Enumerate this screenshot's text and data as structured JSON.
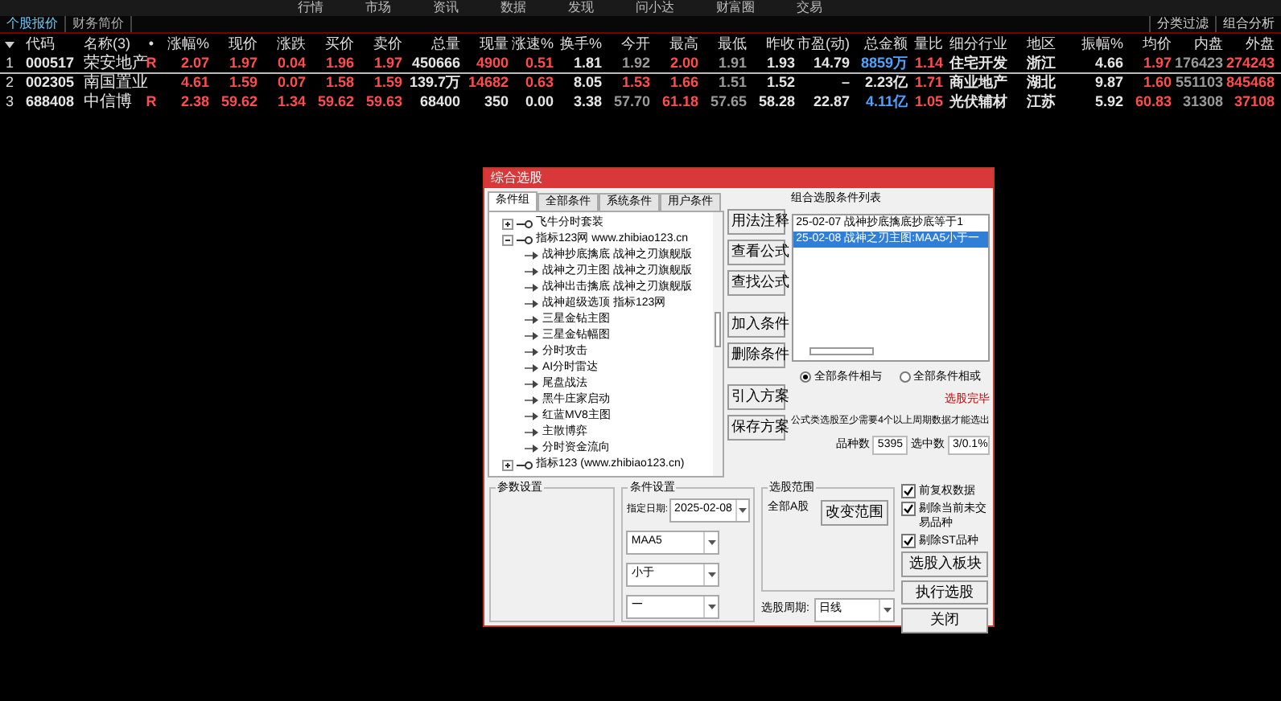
{
  "menu": [
    "行情",
    "市场",
    "资讯",
    "数据",
    "发现",
    "问小达",
    "财富圈",
    "交易"
  ],
  "subtabs": [
    {
      "label": "个股报价",
      "selected": true
    },
    {
      "label": "财务简价",
      "selected": false
    }
  ],
  "filters": [
    "分类过滤",
    "组合分析"
  ],
  "table": {
    "columns": [
      "代码",
      "名称(3)",
      "•",
      "涨幅%",
      "现价",
      "涨跌",
      "买价",
      "卖价",
      "总量",
      "现量",
      "涨速%",
      "换手%",
      "今开",
      "最高",
      "最低",
      "昨收",
      "市盈(动)",
      "总金额",
      "量比",
      "细分行业",
      "地区",
      "振幅%",
      "均价",
      "内盘",
      "外盘"
    ],
    "rows": [
      {
        "num": "1",
        "selected": true,
        "cells": [
          {
            "text": "000517",
            "kind": "flat"
          },
          {
            "text": "荣安地产",
            "kind": "flat"
          },
          {
            "text": "R",
            "kind": "up"
          },
          {
            "text": "2.07",
            "kind": "up"
          },
          {
            "text": "1.97",
            "kind": "up"
          },
          {
            "text": "0.04",
            "kind": "up"
          },
          {
            "text": "1.96",
            "kind": "up"
          },
          {
            "text": "1.97",
            "kind": "up"
          },
          {
            "text": "450666",
            "kind": "flat"
          },
          {
            "text": "4900",
            "kind": "up"
          },
          {
            "text": "0.51",
            "kind": "up"
          },
          {
            "text": "1.81",
            "kind": "flat"
          },
          {
            "text": "1.92",
            "kind": "down"
          },
          {
            "text": "2.00",
            "kind": "up"
          },
          {
            "text": "1.91",
            "kind": "down"
          },
          {
            "text": "1.93",
            "kind": "flat"
          },
          {
            "text": "14.79",
            "kind": "flat"
          },
          {
            "text": "8859万",
            "kind": "amount"
          },
          {
            "text": "1.14",
            "kind": "up"
          },
          {
            "text": "住宅开发",
            "kind": "flat"
          },
          {
            "text": "浙江",
            "kind": "flat"
          },
          {
            "text": "4.66",
            "kind": "flat"
          },
          {
            "text": "1.97",
            "kind": "up"
          },
          {
            "text": "176423",
            "kind": "down"
          },
          {
            "text": "274243",
            "kind": "up"
          }
        ]
      },
      {
        "num": "2",
        "selected": false,
        "cells": [
          {
            "text": "002305",
            "kind": "flat"
          },
          {
            "text": "南国置业",
            "kind": "flat"
          },
          {
            "text": ""
          },
          {
            "text": "4.61",
            "kind": "up"
          },
          {
            "text": "1.59",
            "kind": "up"
          },
          {
            "text": "0.07",
            "kind": "up"
          },
          {
            "text": "1.58",
            "kind": "up"
          },
          {
            "text": "1.59",
            "kind": "up"
          },
          {
            "text": "139.7万",
            "kind": "flat"
          },
          {
            "text": "14682",
            "kind": "up"
          },
          {
            "text": "0.63",
            "kind": "up"
          },
          {
            "text": "8.05",
            "kind": "flat"
          },
          {
            "text": "1.53",
            "kind": "up"
          },
          {
            "text": "1.66",
            "kind": "up"
          },
          {
            "text": "1.51",
            "kind": "down"
          },
          {
            "text": "1.52",
            "kind": "flat"
          },
          {
            "text": "–",
            "kind": "flat"
          },
          {
            "text": "2.23亿",
            "kind": "flat"
          },
          {
            "text": "1.71",
            "kind": "up"
          },
          {
            "text": "商业地产",
            "kind": "flat"
          },
          {
            "text": "湖北",
            "kind": "flat"
          },
          {
            "text": "9.87",
            "kind": "flat"
          },
          {
            "text": "1.60",
            "kind": "up"
          },
          {
            "text": "551103",
            "kind": "down"
          },
          {
            "text": "845468",
            "kind": "up"
          }
        ]
      },
      {
        "num": "3",
        "selected": false,
        "cells": [
          {
            "text": "688408",
            "kind": "flat"
          },
          {
            "text": "中信博",
            "kind": "flat"
          },
          {
            "text": "R",
            "kind": "up"
          },
          {
            "text": "2.38",
            "kind": "up"
          },
          {
            "text": "59.62",
            "kind": "up"
          },
          {
            "text": "1.34",
            "kind": "up"
          },
          {
            "text": "59.62",
            "kind": "up"
          },
          {
            "text": "59.63",
            "kind": "up"
          },
          {
            "text": "68400",
            "kind": "flat"
          },
          {
            "text": "350",
            "kind": "flat"
          },
          {
            "text": "0.00",
            "kind": "flat"
          },
          {
            "text": "3.38",
            "kind": "flat"
          },
          {
            "text": "57.70",
            "kind": "down"
          },
          {
            "text": "61.18",
            "kind": "up"
          },
          {
            "text": "57.65",
            "kind": "down"
          },
          {
            "text": "58.28",
            "kind": "flat"
          },
          {
            "text": "22.87",
            "kind": "flat"
          },
          {
            "text": "4.11亿",
            "kind": "amount"
          },
          {
            "text": "1.05",
            "kind": "up"
          },
          {
            "text": "光伏辅材",
            "kind": "flat"
          },
          {
            "text": "江苏",
            "kind": "flat"
          },
          {
            "text": "5.92",
            "kind": "flat"
          },
          {
            "text": "60.83",
            "kind": "up"
          },
          {
            "text": "31308",
            "kind": "down"
          },
          {
            "text": "37108",
            "kind": "up"
          }
        ]
      }
    ]
  },
  "dialog": {
    "title": "综合选股",
    "tabs": [
      {
        "label": "条件组",
        "selected": true
      },
      {
        "label": "全部条件",
        "selected": false
      },
      {
        "label": "系统条件",
        "selected": false
      },
      {
        "label": "用户条件",
        "selected": false
      }
    ],
    "tree": [
      {
        "label": "飞牛分时套装",
        "expanded": false
      },
      {
        "label": "指标123网 www.zhibiao123.cn",
        "expanded": true,
        "children": [
          {
            "label": "战神抄底擒底 战神之刃旗舰版"
          },
          {
            "label": "战神之刃主图 战神之刃旗舰版"
          },
          {
            "label": "战神出击擒底 战神之刃旗舰版"
          },
          {
            "label": "战神超级选顶 指标123网"
          },
          {
            "label": "三星金钻主图"
          },
          {
            "label": "三星金钻幅图"
          },
          {
            "label": "分时攻击"
          },
          {
            "label": "AI分时雷达"
          },
          {
            "label": "尾盘战法"
          },
          {
            "label": "黑牛庄家启动"
          },
          {
            "label": "红蓝MV8主图"
          },
          {
            "label": "主散博弈"
          },
          {
            "label": "分时资金流向"
          }
        ]
      },
      {
        "label": "指标123  (www.zhibiao123.cn)",
        "expanded": false
      }
    ],
    "side_buttons": [
      [
        "用法注释",
        "查看公式",
        "查找公式"
      ],
      [
        "加入条件",
        "删除条件"
      ],
      [
        "引入方案",
        "保存方案"
      ]
    ],
    "list_title": "组合选股条件列表",
    "conditions": [
      {
        "label": "25-02-07 战神抄底擒底抄底等于1",
        "selected": false
      },
      {
        "label": "25-02-08 战神之刃主图:MAA5小于一",
        "selected": true
      }
    ],
    "logic": [
      {
        "label": "全部条件相与",
        "selected": true
      },
      {
        "label": "全部条件相或",
        "selected": false
      }
    ],
    "status": "选股完毕",
    "note": "公式类选股至少需要4个以上周期数据才能选出",
    "count_label": "品种数",
    "count": "5395",
    "hit_label": "选中数",
    "hit": "3/0.1%",
    "param_title": "参数设置",
    "cond_title": "条件设置",
    "date_label": "指定日期:",
    "date": "2025-02-08",
    "selects": [
      "MAA5",
      "小于",
      "一"
    ],
    "range_title": "选股范围",
    "range": "全部A股",
    "range_button": "改变范围",
    "period_label": "选股周期:",
    "period": "日线",
    "options": [
      {
        "label": "前复权数据",
        "checked": true
      },
      {
        "label": "剔除当前未交易品种",
        "checked": true
      },
      {
        "label": "剔除ST品种",
        "checked": true
      }
    ],
    "actions": [
      "选股入板块",
      "执行选股",
      "关闭"
    ]
  }
}
